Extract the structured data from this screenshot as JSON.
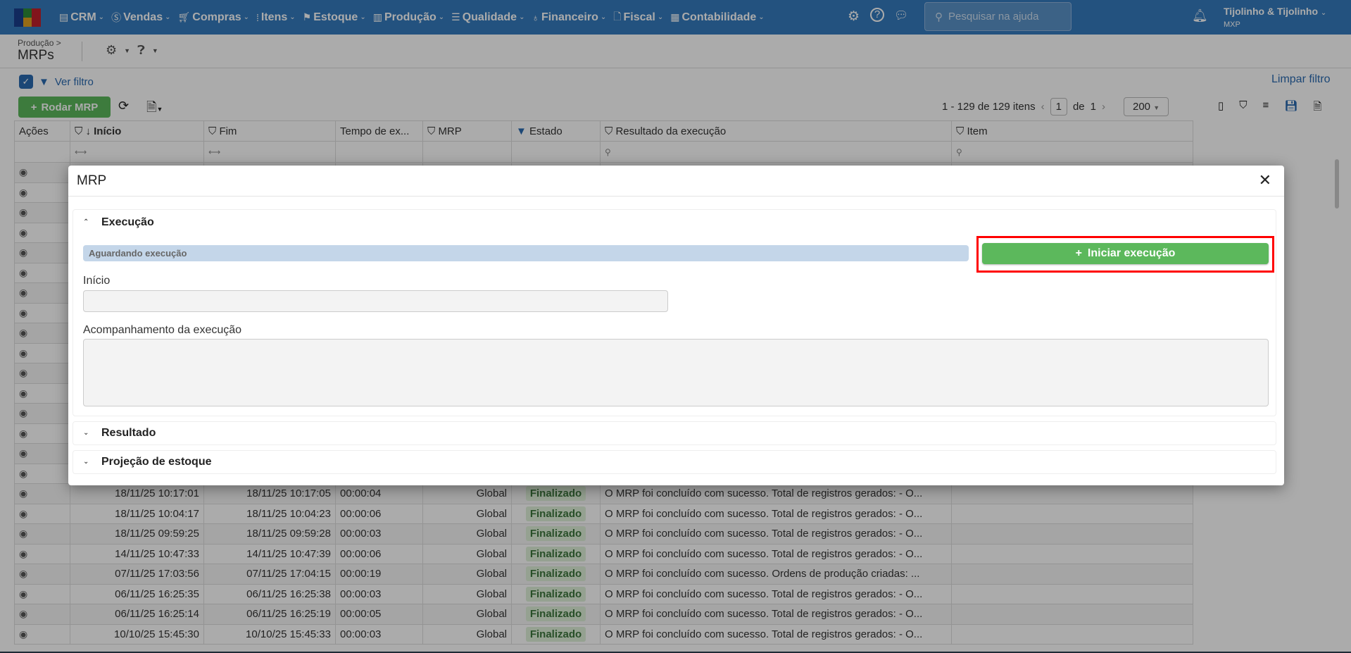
{
  "topbar": {
    "nav": [
      {
        "label": "CRM",
        "icon": "crm-icon"
      },
      {
        "label": "Vendas",
        "icon": "dollar-icon"
      },
      {
        "label": "Compras",
        "icon": "cart-icon"
      },
      {
        "label": "Itens",
        "icon": "items-icon"
      },
      {
        "label": "Estoque",
        "icon": "stock-icon"
      },
      {
        "label": "Produção",
        "icon": "factory-icon"
      },
      {
        "label": "Qualidade",
        "icon": "checklist-icon"
      },
      {
        "label": "Financeiro",
        "icon": "money-bag-icon"
      },
      {
        "label": "Fiscal",
        "icon": "document-icon"
      },
      {
        "label": "Contabilidade",
        "icon": "calculator-icon"
      }
    ],
    "search_placeholder": "Pesquisar na ajuda",
    "user_name": "Tijolinho & Tijolinho",
    "user_company": "MXP"
  },
  "header": {
    "breadcrumb": "Produção >",
    "title": "MRPs"
  },
  "filter": {
    "label": "Ver filtro",
    "clear": "Limpar filtro"
  },
  "toolbar": {
    "run_label": "Rodar MRP"
  },
  "pager": {
    "summary": "1 - 129 de 129 itens",
    "page": "1",
    "of": "de",
    "total_pages": "1",
    "page_size": "200"
  },
  "table": {
    "columns": [
      "Ações",
      "Início",
      "Fim",
      "Tempo de ex...",
      "MRP",
      "Estado",
      "Resultado da execução",
      "Item"
    ],
    "rows": [
      [
        "18/11/25 10:17:01",
        "18/11/25 10:17:05",
        "00:00:04",
        "Global",
        "Finalizado",
        "O MRP foi concluído com sucesso. Total de registros gerados: - O..."
      ],
      [
        "18/11/25 10:04:17",
        "18/11/25 10:04:23",
        "00:00:06",
        "Global",
        "Finalizado",
        "O MRP foi concluído com sucesso. Total de registros gerados: - O..."
      ],
      [
        "18/11/25 09:59:25",
        "18/11/25 09:59:28",
        "00:00:03",
        "Global",
        "Finalizado",
        "O MRP foi concluído com sucesso. Total de registros gerados: - O..."
      ],
      [
        "14/11/25 10:47:33",
        "14/11/25 10:47:39",
        "00:00:06",
        "Global",
        "Finalizado",
        "O MRP foi concluído com sucesso. Total de registros gerados: - O..."
      ],
      [
        "07/11/25 17:03:56",
        "07/11/25 17:04:15",
        "00:00:19",
        "Global",
        "Finalizado",
        "O MRP foi concluído com sucesso. Ordens de produção criadas: ..."
      ],
      [
        "06/11/25 16:25:35",
        "06/11/25 16:25:38",
        "00:00:03",
        "Global",
        "Finalizado",
        "O MRP foi concluído com sucesso. Total de registros gerados: - O..."
      ],
      [
        "06/11/25 16:25:14",
        "06/11/25 16:25:19",
        "00:00:05",
        "Global",
        "Finalizado",
        "O MRP foi concluído com sucesso. Total de registros gerados: - O..."
      ],
      [
        "10/10/25 15:45:30",
        "10/10/25 15:45:33",
        "00:00:03",
        "Global",
        "Finalizado",
        "O MRP foi concluído com sucesso. Total de registros gerados: - O..."
      ]
    ]
  },
  "modal": {
    "title": "MRP",
    "sections": {
      "execucao": "Execução",
      "resultado": "Resultado",
      "projecao": "Projeção de estoque"
    },
    "status": "Aguardando execução",
    "start_label": "Iniciar execução",
    "inicio_label": "Início",
    "inicio_value": "",
    "acompanhamento_label": "Acompanhamento da execução",
    "acompanhamento_value": ""
  },
  "colors": {
    "topbar": "#357bbe",
    "success": "#5cb85c",
    "highlight": "#ff0000",
    "status_bar": "#c4d6e9"
  }
}
